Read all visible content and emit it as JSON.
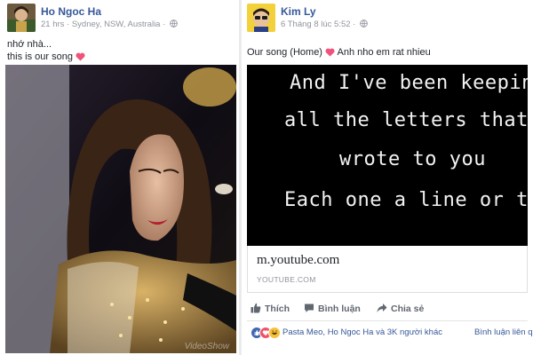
{
  "left_post": {
    "author": "Ho Ngoc Ha",
    "meta": "21 hrs · Sydney, NSW, Australia ·",
    "line1": "nhớ nhà...",
    "line2": "this is our song",
    "watermark": "VideoShow"
  },
  "right_post": {
    "author": "Kim Ly",
    "meta": "6 Tháng 8 lúc 5:52 ·",
    "text": "Our song (Home)",
    "text_after_heart": "Anh nho em rat nhieu",
    "lyrics": [
      "And I've been keeping",
      "all the letters that I",
      "wrote to you",
      "Each one a line or two"
    ],
    "link_title": "m.youtube.com",
    "link_domain": "YOUTUBE.COM",
    "actions": {
      "like": "Thích",
      "comment": "Bình luận",
      "share": "Chia sẻ"
    },
    "reactions_text": "Pasta Meo, Ho Ngoc Ha và 3K người khác",
    "comments_link": "Bình luận liên q"
  },
  "colors": {
    "link_blue": "#365899",
    "meta_gray": "#90949c",
    "heart_pink": "#f0527a",
    "like_blue": "#4267b2",
    "love_red": "#f25268",
    "haha_yellow": "#f7c13a"
  },
  "icons": [
    "globe-icon",
    "heart-icon",
    "like-icon",
    "comment-icon",
    "share-icon",
    "love-reaction-icon",
    "haha-reaction-icon"
  ]
}
